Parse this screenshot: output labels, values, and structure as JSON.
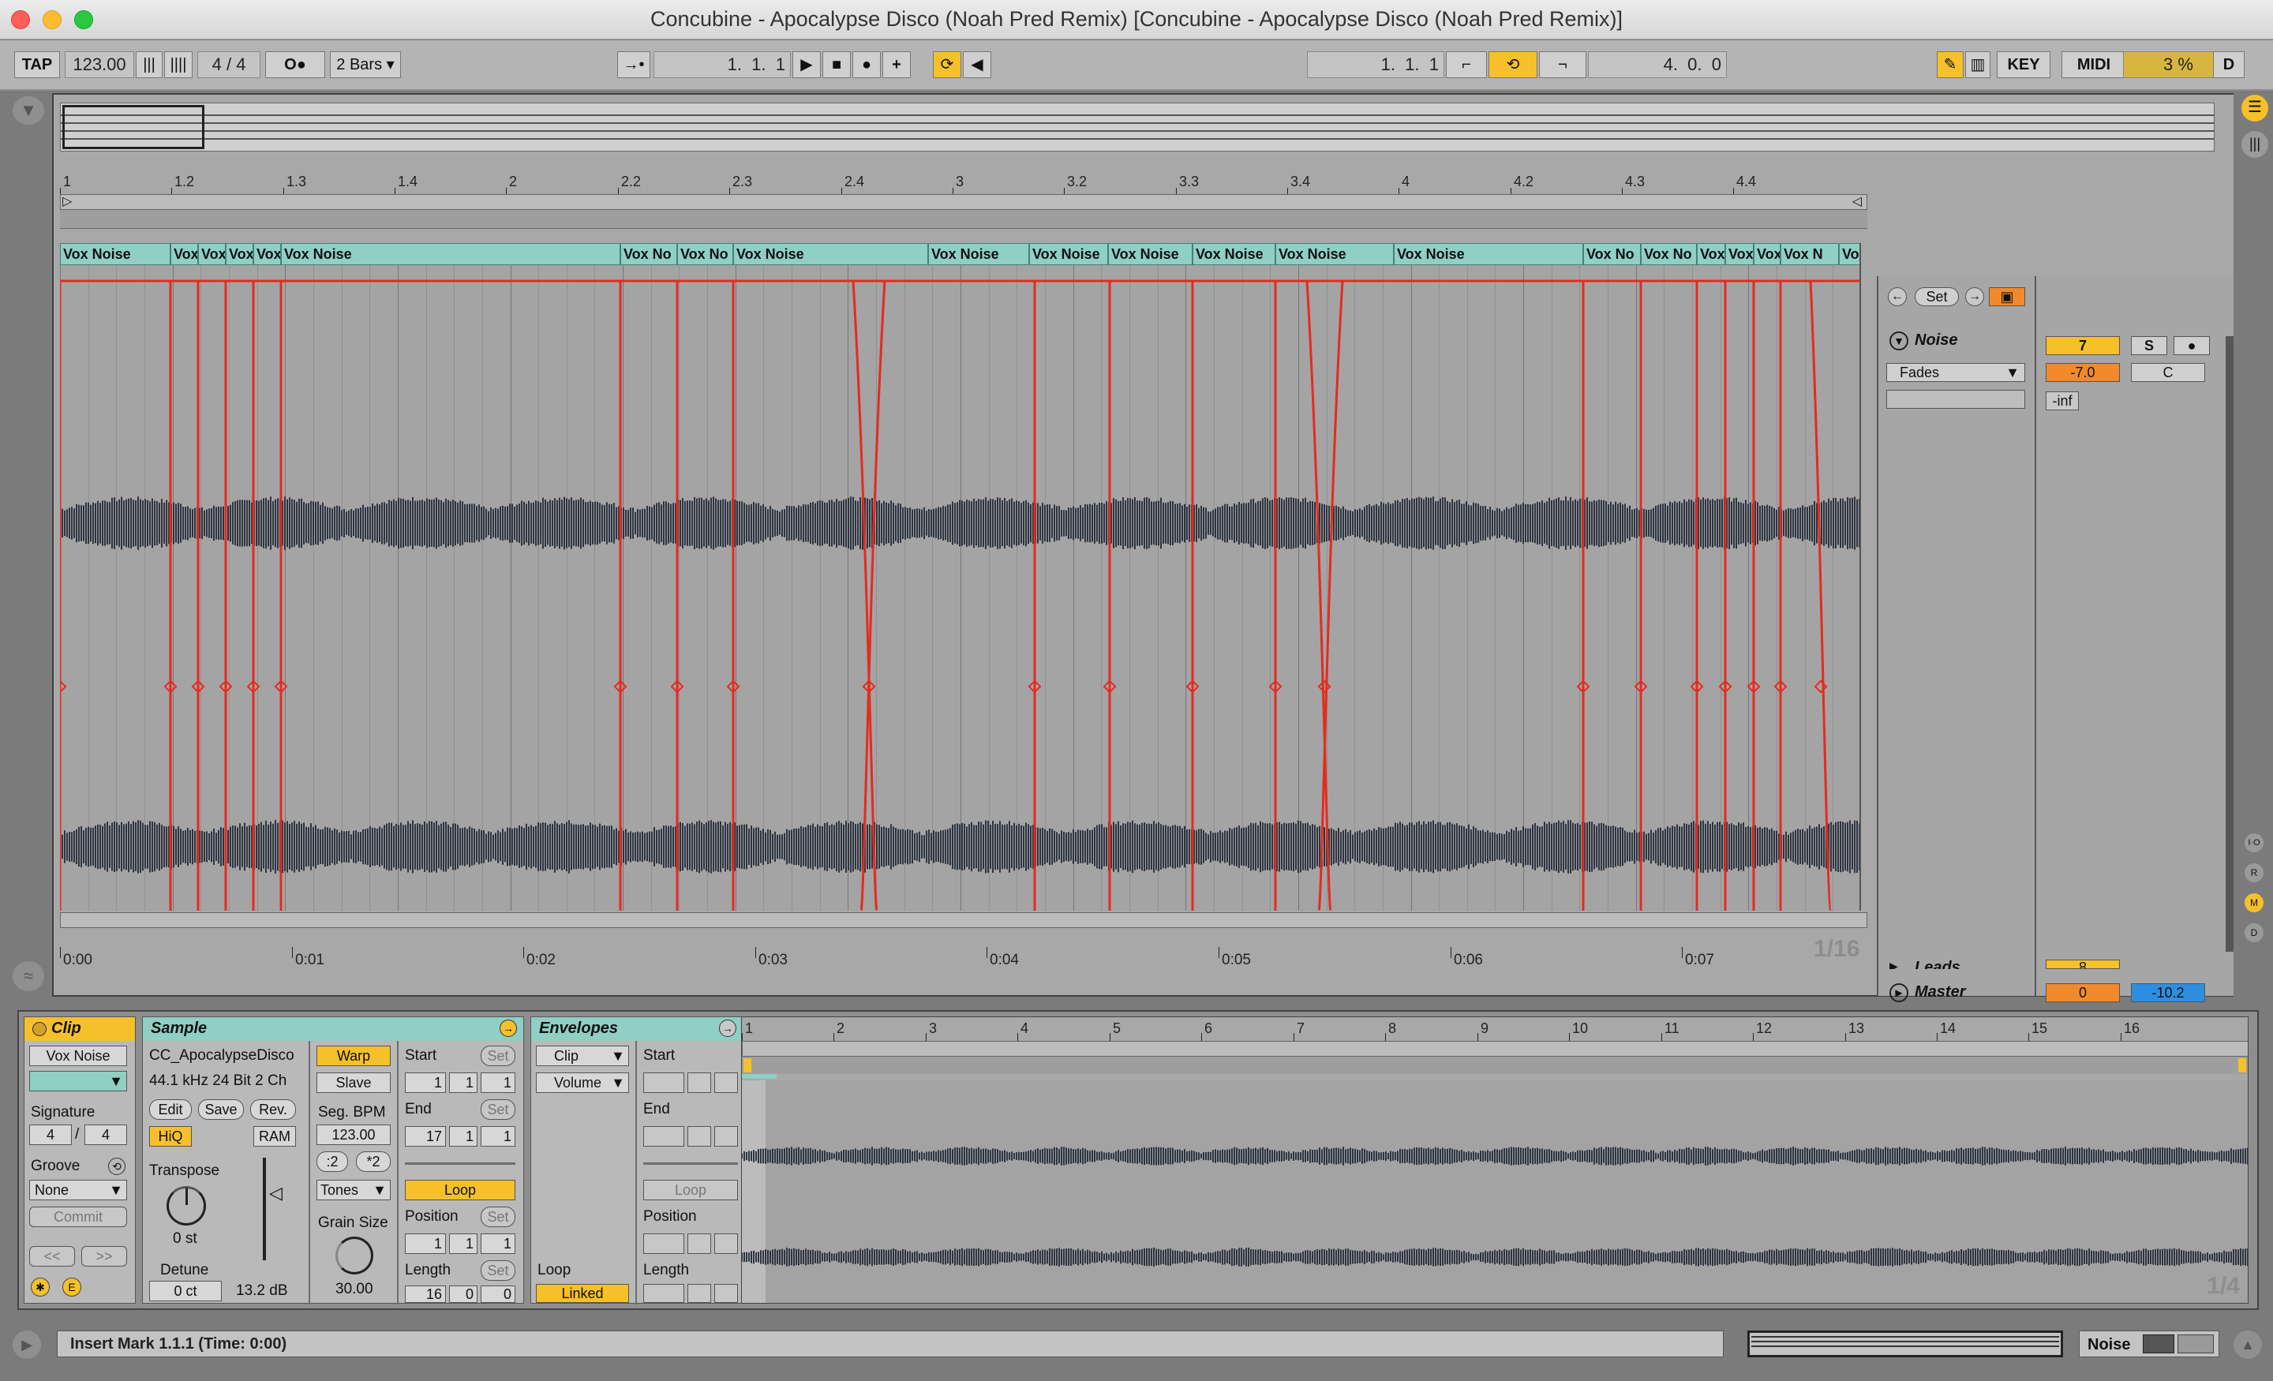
{
  "window": {
    "title": "Concubine - Apocalypse Disco (Noah Pred Remix)  [Concubine - Apocalypse Disco (Noah Pred Remix)]"
  },
  "control_bar": {
    "tap": "TAP",
    "tempo": "123.00",
    "signature_num": "4",
    "signature_sep": "/",
    "signature_den": "4",
    "metronome": "O●",
    "quantize": "2 Bars",
    "arrangement_position": "1.  1.  1",
    "loop_start": "1.  1.  1",
    "loop_length": "4.  0.  0",
    "key": "KEY",
    "midi": "MIDI",
    "cpu": "3 %",
    "disk": "D"
  },
  "ruler": {
    "bars": [
      "1",
      "1.2",
      "1.3",
      "1.4",
      "2",
      "2.2",
      "2.3",
      "2.4",
      "3",
      "3.2",
      "3.3",
      "3.4",
      "4",
      "4.2",
      "4.3",
      "4.4"
    ],
    "time": [
      "0:00",
      "0:01",
      "0:02",
      "0:03",
      "0:04",
      "0:05",
      "0:06",
      "0:07"
    ],
    "zoom": "1/16"
  },
  "clips": [
    "Vox Noise",
    "Vox",
    "Vox",
    "Vox",
    "Vox",
    "Vox Noise",
    "Vox No",
    "Vox No",
    "Vox Noise",
    "Vox Noise",
    "Vox Noise",
    "Vox Noise",
    "Vox Noise",
    "Vox Noise",
    "Vox Noise",
    "Vox No",
    "Vox No",
    "Vox",
    "Vox",
    "Vox",
    "Vox N",
    "Vox Noise"
  ],
  "mixer": {
    "set": "Set",
    "track_name": "Noise",
    "track_number": "7",
    "solo": "S",
    "input": "Fades",
    "volume": "-7.0",
    "pan": "C",
    "peak": "-inf",
    "next_track": "Leads",
    "next_number": "8",
    "master_name": "Master",
    "master_number": "0",
    "master_volume": "-10.2"
  },
  "clip_view": {
    "clip_title": "Clip",
    "clip_name": "Vox Noise",
    "signature_label": "Signature",
    "sig_num": "4",
    "sig_sep": "/",
    "sig_den": "4",
    "groove_label": "Groove",
    "groove_value": "None",
    "commit": "Commit",
    "nav_prev": "<<",
    "nav_next": ">>",
    "sample_title": "Sample",
    "sample_file": "CC_ApocalypseDisco",
    "sample_info": "44.1 kHz 24 Bit 2 Ch",
    "edit": "Edit",
    "save": "Save",
    "rev": "Rev.",
    "hiq": "HiQ",
    "ram": "RAM",
    "transpose_label": "Transpose",
    "transpose_value": "0 st",
    "detune_label": "Detune",
    "detune_value": "0 ct",
    "gain_value": "13.2 dB",
    "warp": "Warp",
    "slave": "Slave",
    "seg_bpm_label": "Seg. BPM",
    "seg_bpm": "123.00",
    "half": ":2",
    "double": "*2",
    "warp_mode": "Tones",
    "grain_label": "Grain Size",
    "grain_value": "30.00",
    "start_label": "Start",
    "set": "Set",
    "start": [
      "1",
      "1",
      "1"
    ],
    "end_label": "End",
    "end": [
      "17",
      "1",
      "1"
    ],
    "loop": "Loop",
    "position_label": "Position",
    "position": [
      "1",
      "1",
      "1"
    ],
    "length_label": "Length",
    "length": [
      "16",
      "0",
      "0"
    ],
    "env_title": "Envelopes",
    "env_device": "Clip",
    "env_control": "Volume",
    "env_loop_label": "Loop",
    "linked": "Linked"
  },
  "sample_editor": {
    "bars": [
      "1",
      "2",
      "3",
      "4",
      "5",
      "6",
      "7",
      "8",
      "9",
      "10",
      "11",
      "12",
      "13",
      "14",
      "15",
      "16"
    ],
    "zoom": "1/4"
  },
  "status": {
    "message": "Insert Mark 1.1.1 (Time: 0:00)",
    "track": "Noise"
  },
  "colors": {
    "accent": "#f5c02a",
    "clip": "#8fcfc4",
    "envelope": "#e52b1e",
    "waveform": "#2d3440",
    "master_blue": "#2d8ee0",
    "vol_orange": "#f08a2c"
  }
}
